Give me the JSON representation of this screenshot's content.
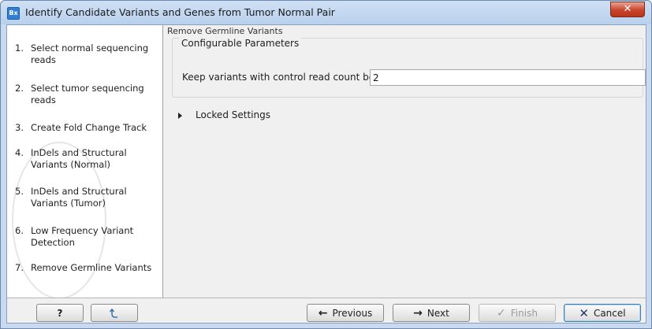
{
  "window": {
    "title": "Identify Candidate Variants and Genes from Tumor Normal Pair",
    "app_icon_text": "Bx",
    "close_symbol": "✕"
  },
  "steps": [
    {
      "num": "1.",
      "label": "Select normal sequencing reads"
    },
    {
      "num": "2.",
      "label": "Select tumor sequencing reads"
    },
    {
      "num": "3.",
      "label": "Create Fold Change Track"
    },
    {
      "num": "4.",
      "label": "InDels and Structural Variants (Normal)"
    },
    {
      "num": "5.",
      "label": "InDels and Structural Variants (Tumor)"
    },
    {
      "num": "6.",
      "label": "Low Frequency Variant Detection"
    },
    {
      "num": "7.",
      "label": "Remove Germline Variants"
    }
  ],
  "content": {
    "section_title": "Remove Germline Variants",
    "group_title": "Configurable Parameters",
    "param_label": "Keep variants with control read count below",
    "param_value": "2",
    "locked_label": "Locked Settings"
  },
  "buttons": {
    "help": "?",
    "previous": "Previous",
    "next": "Next",
    "finish": "Finish",
    "cancel": "Cancel"
  },
  "icons": {
    "help": "question-icon",
    "reset": "reset-icon",
    "previous": "arrow-left-icon",
    "next": "arrow-right-icon",
    "finish": "checkmark-icon",
    "cancel": "close-x-icon"
  }
}
